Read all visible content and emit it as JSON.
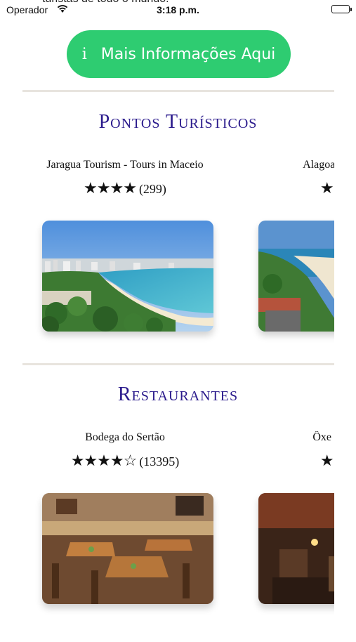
{
  "overflow_text": "turistas de todo o mundo.",
  "status_bar": {
    "carrier": "Operador",
    "time": "3:18 p.m."
  },
  "info_button": {
    "icon": "i",
    "label": "Mais Informações Aqui"
  },
  "sections": [
    {
      "title": "Pontos Turísticos",
      "cards": [
        {
          "name": "Jaragua Tourism - Tours in Maceio",
          "stars": "★★★★",
          "count": "(299)"
        },
        {
          "name": "Alagoas Turismo",
          "stars": "★★★",
          "count": ""
        }
      ]
    },
    {
      "title": "Restaurantes",
      "cards": [
        {
          "name": "Bodega do Sertão",
          "stars": "★★★★☆",
          "count": "(13395)"
        },
        {
          "name": "Ôxe Comida",
          "stars": "★★★",
          "count": ""
        }
      ]
    }
  ]
}
